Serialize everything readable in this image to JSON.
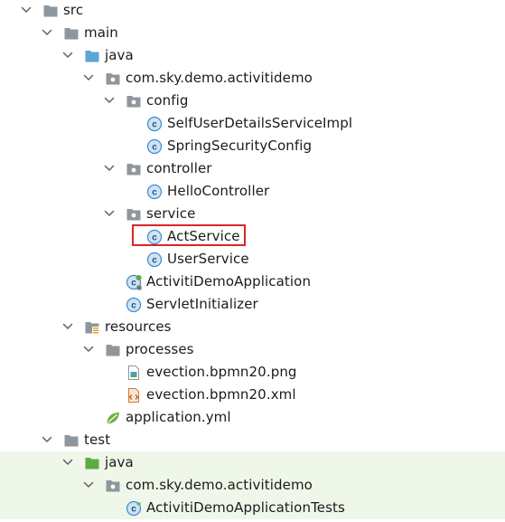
{
  "colors": {
    "folder_gray": "#8e969e",
    "folder_source_blue": "#5aa6d6",
    "folder_test_green": "#5daa45",
    "class_icon_blue": "#3e8ad0",
    "selection_border": "#d9252b",
    "test_background": "#eef7e8"
  },
  "tree": [
    {
      "id": "src",
      "label": "src",
      "depth": 0,
      "icon": "folder-icon",
      "expanded": true
    },
    {
      "id": "main",
      "label": "main",
      "depth": 1,
      "icon": "folder-icon",
      "expanded": true
    },
    {
      "id": "java-main",
      "label": "java",
      "depth": 2,
      "icon": "source-folder-icon",
      "expanded": true
    },
    {
      "id": "pkg-main",
      "label": "com.sky.demo.activitidemo",
      "depth": 3,
      "icon": "package-icon",
      "expanded": true
    },
    {
      "id": "config",
      "label": "config",
      "depth": 4,
      "icon": "package-icon",
      "expanded": true
    },
    {
      "id": "self-user-details",
      "label": "SelfUserDetailsServiceImpl",
      "depth": 5,
      "icon": "class-icon"
    },
    {
      "id": "spring-security-config",
      "label": "SpringSecurityConfig",
      "depth": 5,
      "icon": "class-icon"
    },
    {
      "id": "controller",
      "label": "controller",
      "depth": 4,
      "icon": "package-icon",
      "expanded": true
    },
    {
      "id": "hello-controller",
      "label": "HelloController",
      "depth": 5,
      "icon": "class-icon"
    },
    {
      "id": "service",
      "label": "service",
      "depth": 4,
      "icon": "package-icon",
      "expanded": true
    },
    {
      "id": "act-service",
      "label": "ActService",
      "depth": 5,
      "icon": "class-icon",
      "highlighted": true
    },
    {
      "id": "user-service",
      "label": "UserService",
      "depth": 5,
      "icon": "class-icon"
    },
    {
      "id": "activiti-demo-application",
      "label": "ActivitiDemoApplication",
      "depth": 4,
      "icon": "spring-boot-class-icon"
    },
    {
      "id": "servlet-initializer",
      "label": "ServletInitializer",
      "depth": 4,
      "icon": "class-icon"
    },
    {
      "id": "resources",
      "label": "resources",
      "depth": 2,
      "icon": "resources-folder-icon",
      "expanded": true
    },
    {
      "id": "processes",
      "label": "processes",
      "depth": 3,
      "icon": "folder-icon",
      "expanded": true
    },
    {
      "id": "evection-png",
      "label": "evection.bpmn20.png",
      "depth": 4,
      "icon": "image-file-icon"
    },
    {
      "id": "evection-xml",
      "label": "evection.bpmn20.xml",
      "depth": 4,
      "icon": "xml-file-icon"
    },
    {
      "id": "application-yml",
      "label": "application.yml",
      "depth": 3,
      "icon": "yaml-leaf-icon"
    },
    {
      "id": "test",
      "label": "test",
      "depth": 1,
      "icon": "folder-icon",
      "expanded": true
    },
    {
      "id": "java-test",
      "label": "java",
      "depth": 2,
      "icon": "test-source-folder-icon",
      "expanded": true,
      "test": true
    },
    {
      "id": "pkg-test",
      "label": "com.sky.demo.activitidemo",
      "depth": 3,
      "icon": "package-icon",
      "expanded": true,
      "test": true
    },
    {
      "id": "activiti-demo-application-tests",
      "label": "ActivitiDemoApplicationTests",
      "depth": 4,
      "icon": "test-class-icon",
      "test": true
    }
  ]
}
